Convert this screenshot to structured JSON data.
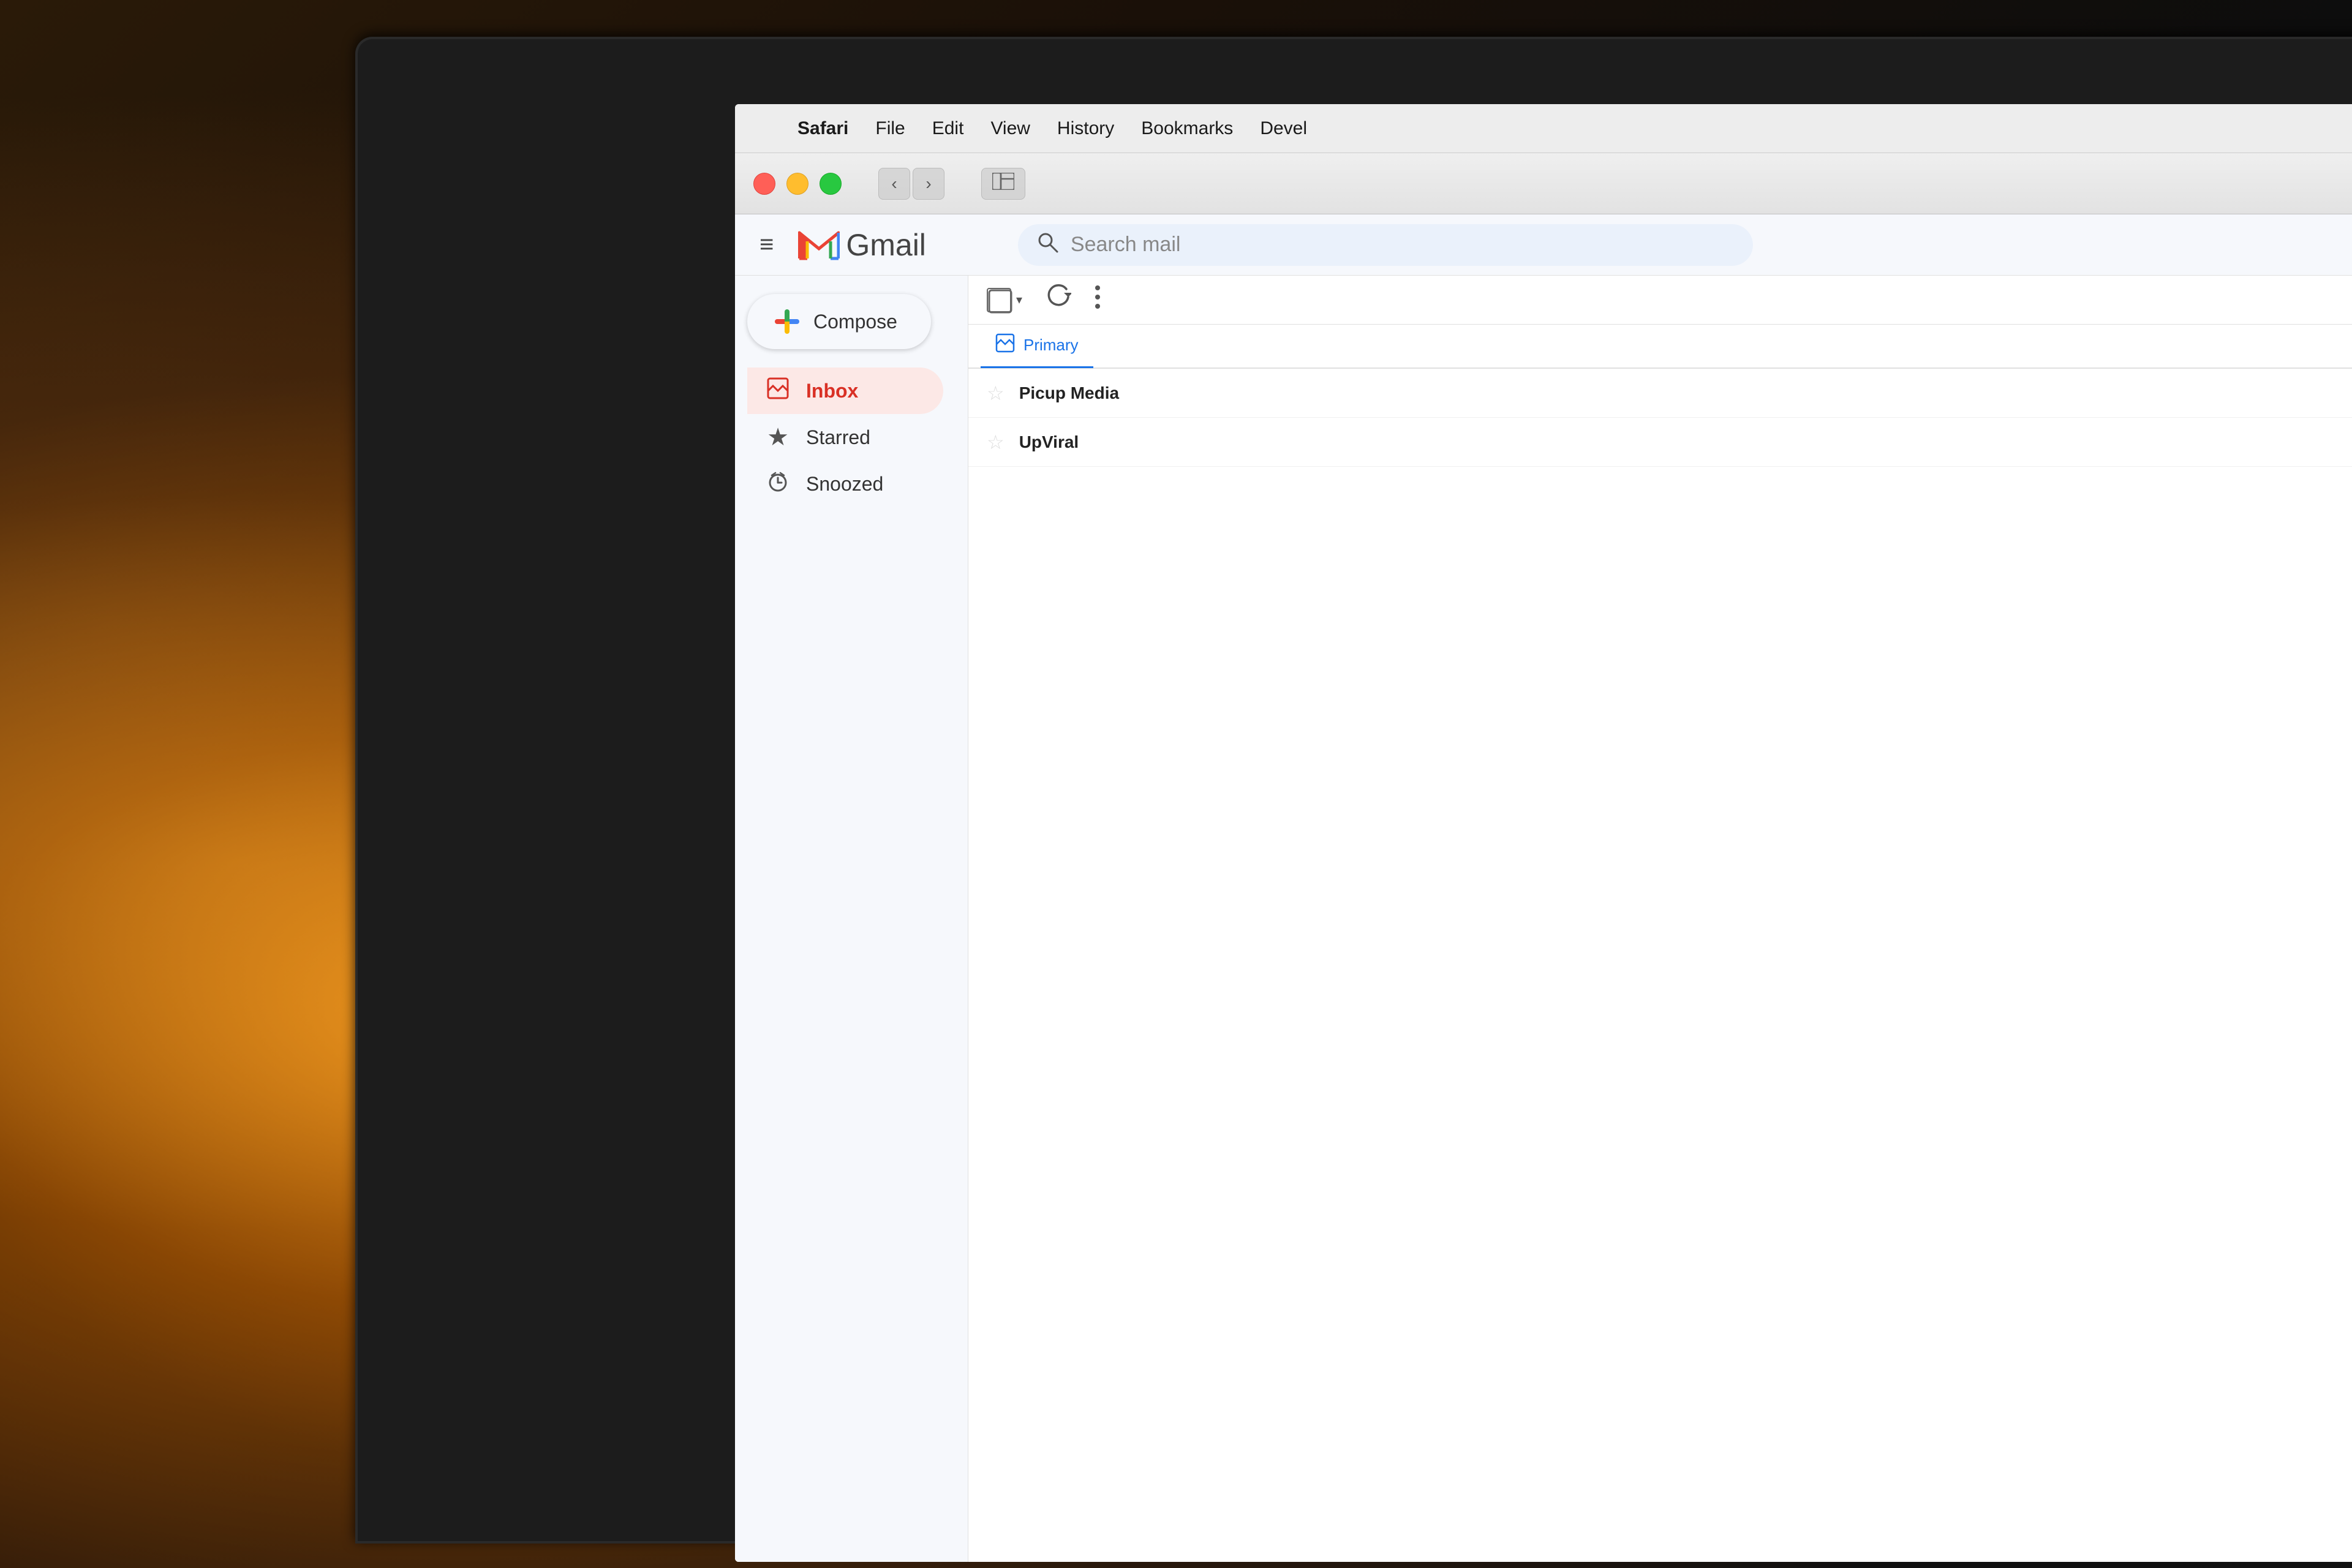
{
  "background": {
    "description": "warm bokeh background with lamp lights"
  },
  "menubar": {
    "apple_symbol": "",
    "items": [
      {
        "id": "safari",
        "label": "Safari",
        "bold": true
      },
      {
        "id": "file",
        "label": "File",
        "bold": false
      },
      {
        "id": "edit",
        "label": "Edit",
        "bold": false
      },
      {
        "id": "view",
        "label": "View",
        "bold": false
      },
      {
        "id": "history",
        "label": "History",
        "bold": false
      },
      {
        "id": "bookmarks",
        "label": "Bookmarks",
        "bold": false
      },
      {
        "id": "devel",
        "label": "Devel",
        "bold": false
      }
    ]
  },
  "browser": {
    "traffic_lights": {
      "red_title": "Close",
      "yellow_title": "Minimize",
      "green_title": "Zoom"
    },
    "back_label": "‹",
    "forward_label": "›",
    "sidebar_toggle": "⊡",
    "grid_icon": "⋮⋮⋮"
  },
  "gmail": {
    "hamburger_label": "≡",
    "logo_text": "Gmail",
    "search_placeholder": "Search mail",
    "compose_label": "Compose",
    "sidebar_items": [
      {
        "id": "inbox",
        "icon": "🔖",
        "label": "Inbox",
        "active": true
      },
      {
        "id": "starred",
        "icon": "★",
        "label": "Starred",
        "active": false
      },
      {
        "id": "snoozed",
        "icon": "🕐",
        "label": "Snoozed",
        "active": false
      }
    ],
    "toolbar": {
      "more_dots": "⋮",
      "refresh": "↻"
    },
    "tabs": [
      {
        "id": "primary",
        "icon": "☐",
        "label": "Primary",
        "active": true
      }
    ],
    "mail_rows": [
      {
        "id": "row1",
        "sender": "Picup Media",
        "starred": false
      },
      {
        "id": "row2",
        "sender": "UpViral",
        "starred": false
      }
    ]
  },
  "colors": {
    "gmail_red": "#EA4335",
    "gmail_blue": "#4285F4",
    "gmail_yellow": "#FBBC05",
    "gmail_green": "#34A853",
    "inbox_active_bg": "#fce8e6",
    "inbox_active_text": "#d93025",
    "compose_plus_red": "#EA4335",
    "compose_plus_blue": "#4285F4",
    "compose_plus_green": "#34A853",
    "compose_plus_yellow": "#FBBC05"
  }
}
